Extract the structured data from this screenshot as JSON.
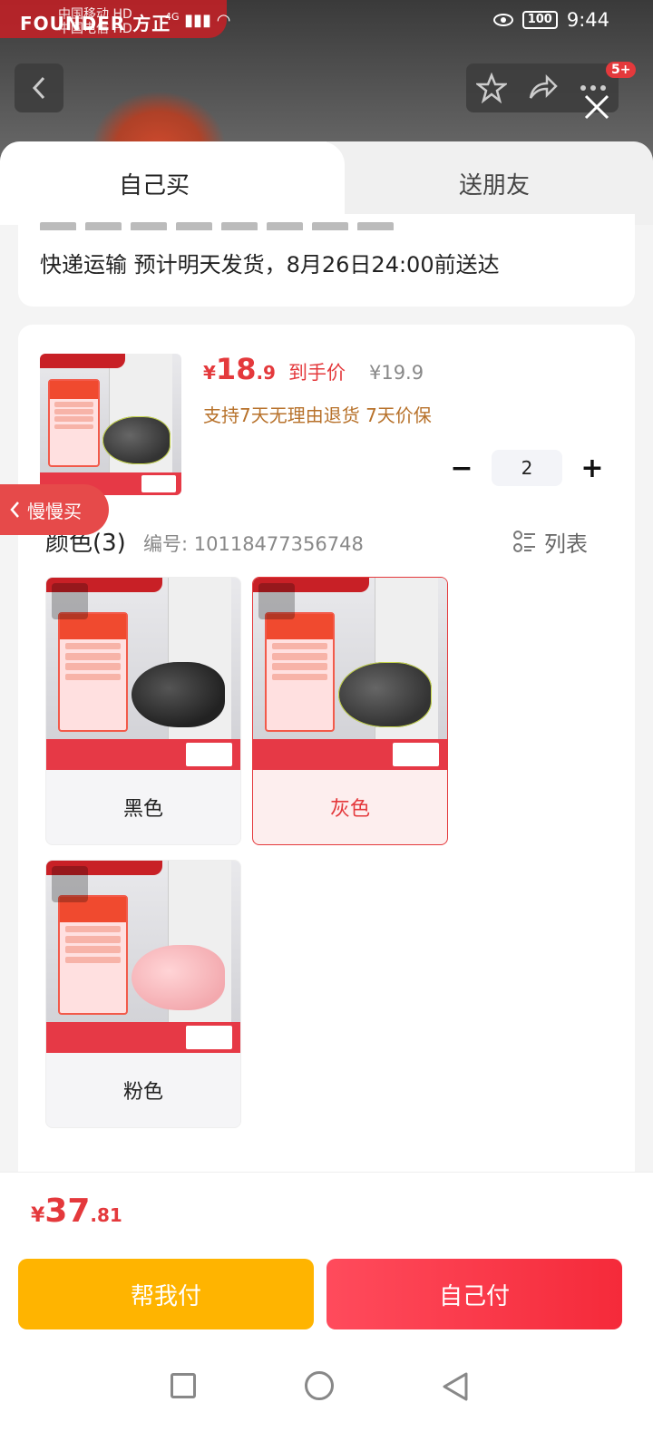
{
  "status_bar": {
    "carrier_1": "中国移动 HD",
    "carrier_2": "中国电信 HD",
    "network": "4G",
    "battery": "100",
    "time": "9:44"
  },
  "background_page": {
    "brand": "FOUNDER 方正"
  },
  "nav": {
    "badge": "5+"
  },
  "tabs": {
    "self_buy": "自己买",
    "gift_friend": "送朋友"
  },
  "delivery": {
    "text": "快递运输 预计明天发货，8月26日24:00前送达"
  },
  "product": {
    "price_currency": "¥",
    "price_integer": "18",
    "price_decimal": ".9",
    "price_label": "到手价",
    "original_price": "¥19.9",
    "services": "支持7天无理由退货  7天价保",
    "quantity": "2",
    "minus": "−",
    "plus": "+"
  },
  "slow_buy": {
    "label": "慢慢买"
  },
  "spec": {
    "title": "颜色(3)",
    "sku_number": "编号: 10118477356748",
    "view_toggle": "列表",
    "options": [
      {
        "label": "黑色",
        "selected": false
      },
      {
        "label": "灰色",
        "selected": true
      },
      {
        "label": "粉色",
        "selected": false
      }
    ]
  },
  "footer": {
    "total_currency": "¥",
    "total_integer": "37",
    "total_decimal": ".81",
    "help_pay": "帮我付",
    "self_pay": "自己付"
  },
  "colors": {
    "accent": "#e4393c",
    "help_button": "#ffb400",
    "service_text": "#b7712a"
  }
}
